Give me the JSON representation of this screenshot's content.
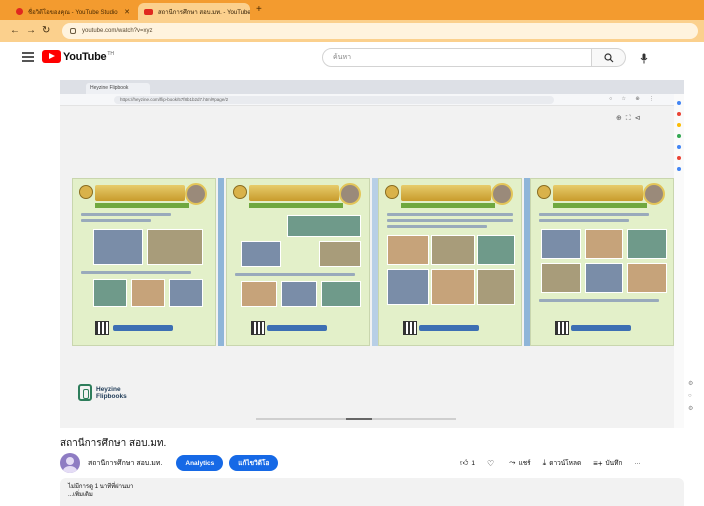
{
  "browser": {
    "tabs": [
      {
        "label": "ชื่อวิดีโอของคุณ - YouTube Studio",
        "active": false
      },
      {
        "label": "สถานีการศึกษา สอบ.มท. - YouTube",
        "active": true
      }
    ],
    "new_tab": "+",
    "url": "youtube.com/watch?v=xyz"
  },
  "youtube": {
    "logo_text": "YouTube",
    "logo_tm": "TH",
    "search_placeholder": "ค้นหา"
  },
  "recording": {
    "inner_tab_label": "Heyzine Flipbook",
    "inner_url": "https://heyzine.com/flip-book/57f8b1b2d7.html#page/2",
    "heyzine_line1": "Heyzine",
    "heyzine_line2": "Flipbooks"
  },
  "video": {
    "title": "สถานีการศึกษา สอบ.มท.",
    "channel_name": "สถานีการศึกษา สอบ.มท.",
    "analytics_label": "Analytics",
    "edit_label": "แก้ไขวิดีโอ",
    "like_count": "1",
    "share_label": "แชร์",
    "download_label": "ดาวน์โหลด",
    "save_label": "บันทึก",
    "more_label": "···",
    "description_line1": "ไม่มีการดู  1 นาทีที่ผ่านมา",
    "description_line2": "...เพิ่มเติม"
  },
  "colors": {
    "tabbar": "#f39b2f",
    "addressbar": "#fbd08d",
    "pill_blue": "#1669e6",
    "youtube_red": "#ff0000"
  }
}
